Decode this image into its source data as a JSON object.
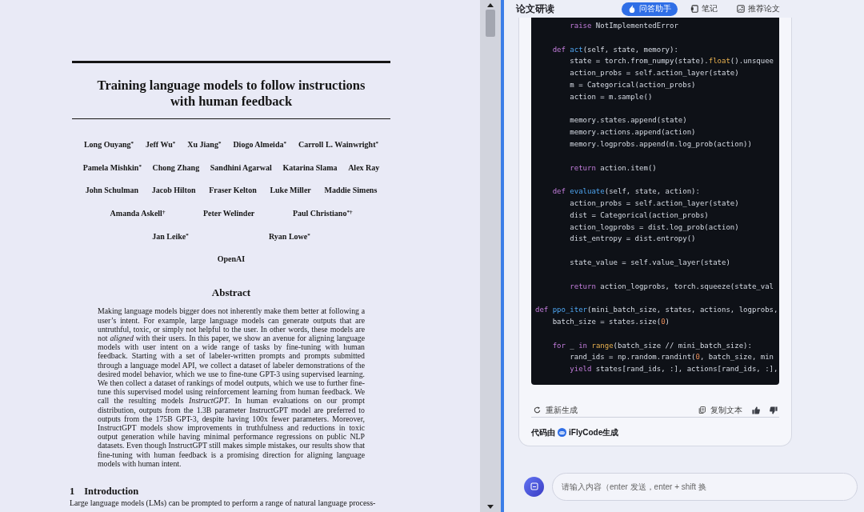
{
  "pdf_viewer": {
    "paper": {
      "title": "Training language models to follow instructions with human feedback",
      "author_rows": [
        [
          "Long Ouyang$^{*}$",
          "Jeff Wu$^{*}$",
          "Xu Jiang$^{*}$",
          "Diogo Almeida$^{*}$",
          "Carroll L. Wainwright$^{*}$"
        ],
        [
          "Pamela Mishkin$^{*}$",
          "Chong Zhang",
          "Sandhini Agarwal",
          "Katarina Slama",
          "Alex Ray"
        ],
        [
          "John Schulman",
          "Jacob Hilton",
          "Fraser Kelton",
          "Luke Miller",
          "Maddie Simens"
        ],
        [
          "Amanda Askell$^{†}$",
          "Peter Welinder",
          "Paul Christiano$^{*†}$"
        ],
        [
          "Jan Leike$^{*}$",
          "Ryan Lowe$^{*}$"
        ]
      ],
      "affiliation": "OpenAI",
      "abstract": {
        "heading": "Abstract",
        "text": "Making language models bigger does not inherently make them better at following a user’s intent. For example, large language models can generate outputs that are untruthful, toxic, or simply not helpful to the user. In other words, these models are not *aligned* with their users. In this paper, we show an avenue for aligning language models with user intent on a wide range of tasks by fine-tuning with human feedback. Starting with a set of labeler-written prompts and prompts submitted through a language model API, we collect a dataset of labeler demonstrations of the desired model behavior, which we use to fine-tune GPT-3 using supervised learning. We then collect a dataset of rankings of model outputs, which we use to further fine-tune this supervised model using reinforcement learning from human feedback. We call the resulting models *InstructGPT*. In human evaluations on our prompt distribution, outputs from the 1.3B parameter InstructGPT model are preferred to outputs from the 175B GPT-3, despite having 100x fewer parameters. Moreover, InstructGPT models show improvements in truthfulness and reductions in toxic output generation while having minimal performance regressions on public NLP datasets. Even though InstructGPT still makes simple mistakes, our results show that fine-tuning with human feedback is a promising direction for aligning language models with human intent."
      },
      "section": {
        "number": "1",
        "title": "Introduction"
      },
      "body_first_line": "Large language models (LMs) can be prompted to perform a range of natural language process-"
    }
  },
  "assistant_panel": {
    "title": "论文研读",
    "tabs": [
      {
        "label": "问答助手",
        "selected": true
      },
      {
        "label": "笔记",
        "selected": false
      },
      {
        "label": "推荐论文",
        "selected": false
      }
    ],
    "answer": {
      "code_blocks": [
        [
          [
            {
              "kind": "keyword",
              "text": "        raise"
            },
            {
              "kind": "plain",
              "text": " NotImplementedError"
            }
          ]
        ],
        [
          [
            {
              "kind": "keyword",
              "text": "    def "
            },
            {
              "kind": "function",
              "text": "act"
            },
            {
              "kind": "plain",
              "text": "(self, state, memory):"
            }
          ],
          [
            {
              "kind": "plain",
              "text": "        state = torch.from_numpy(state)."
            },
            {
              "kind": "builtin",
              "text": "float"
            },
            {
              "kind": "plain",
              "text": "().unsquee"
            }
          ],
          [
            {
              "kind": "plain",
              "text": "        action_probs = self.action_layer(state)"
            }
          ],
          [
            {
              "kind": "plain",
              "text": "        m = Categorical(action_probs)"
            }
          ],
          [
            {
              "kind": "plain",
              "text": "        action = m.sample()"
            }
          ]
        ],
        [
          [
            {
              "kind": "plain",
              "text": "        memory.states.append(state)"
            }
          ],
          [
            {
              "kind": "plain",
              "text": "        memory.actions.append(action)"
            }
          ],
          [
            {
              "kind": "plain",
              "text": "        memory.logprobs.append(m.log_prob(action))"
            }
          ]
        ],
        [
          [
            {
              "kind": "keyword",
              "text": "        return"
            },
            {
              "kind": "plain",
              "text": " action.item()"
            }
          ]
        ],
        [
          [
            {
              "kind": "keyword",
              "text": "    def "
            },
            {
              "kind": "function",
              "text": "evaluate"
            },
            {
              "kind": "plain",
              "text": "(self, state, action):"
            }
          ],
          [
            {
              "kind": "plain",
              "text": "        action_probs = self.action_layer(state)"
            }
          ],
          [
            {
              "kind": "plain",
              "text": "        dist = Categorical(action_probs)"
            }
          ],
          [
            {
              "kind": "plain",
              "text": "        action_logprobs = dist.log_prob(action)"
            }
          ],
          [
            {
              "kind": "plain",
              "text": "        dist_entropy = dist.entropy()"
            }
          ]
        ],
        [
          [
            {
              "kind": "plain",
              "text": "        state_value = self.value_layer(state)"
            }
          ]
        ],
        [
          [
            {
              "kind": "keyword",
              "text": "        return"
            },
            {
              "kind": "plain",
              "text": " action_logprobs, torch.squeeze(state_val"
            }
          ]
        ],
        [
          [
            {
              "kind": "keyword",
              "text": "def "
            },
            {
              "kind": "function",
              "text": "ppo_iter"
            },
            {
              "kind": "plain",
              "text": "(mini_batch_size, states, actions, logprobs,"
            }
          ],
          [
            {
              "kind": "plain",
              "text": "    batch_size = states.size("
            },
            {
              "kind": "number",
              "text": "0"
            },
            {
              "kind": "plain",
              "text": ")"
            }
          ]
        ],
        [
          [
            {
              "kind": "keyword",
              "text": "    for"
            },
            {
              "kind": "plain",
              "text": " _ "
            },
            {
              "kind": "keyword",
              "text": "in "
            },
            {
              "kind": "builtin",
              "text": "range"
            },
            {
              "kind": "plain",
              "text": "(batch_size // mini_batch_size):"
            }
          ],
          [
            {
              "kind": "plain",
              "text": "        rand_ids = np.random.randint("
            },
            {
              "kind": "number",
              "text": "0"
            },
            {
              "kind": "plain",
              "text": ", batch_size, min"
            }
          ],
          [
            {
              "kind": "keyword",
              "text": "        yield"
            },
            {
              "kind": "plain",
              "text": " states[rand_ids, :], actions[rand_ids, :],"
            }
          ]
        ]
      ],
      "regenerate": "重新生成",
      "copy": "复制文本",
      "footer_prefix": "代码由",
      "footer_brand": "iFlyCode生成"
    },
    "input": {
      "placeholder": "请输入内容（enter 发送，enter + shift 换"
    }
  }
}
